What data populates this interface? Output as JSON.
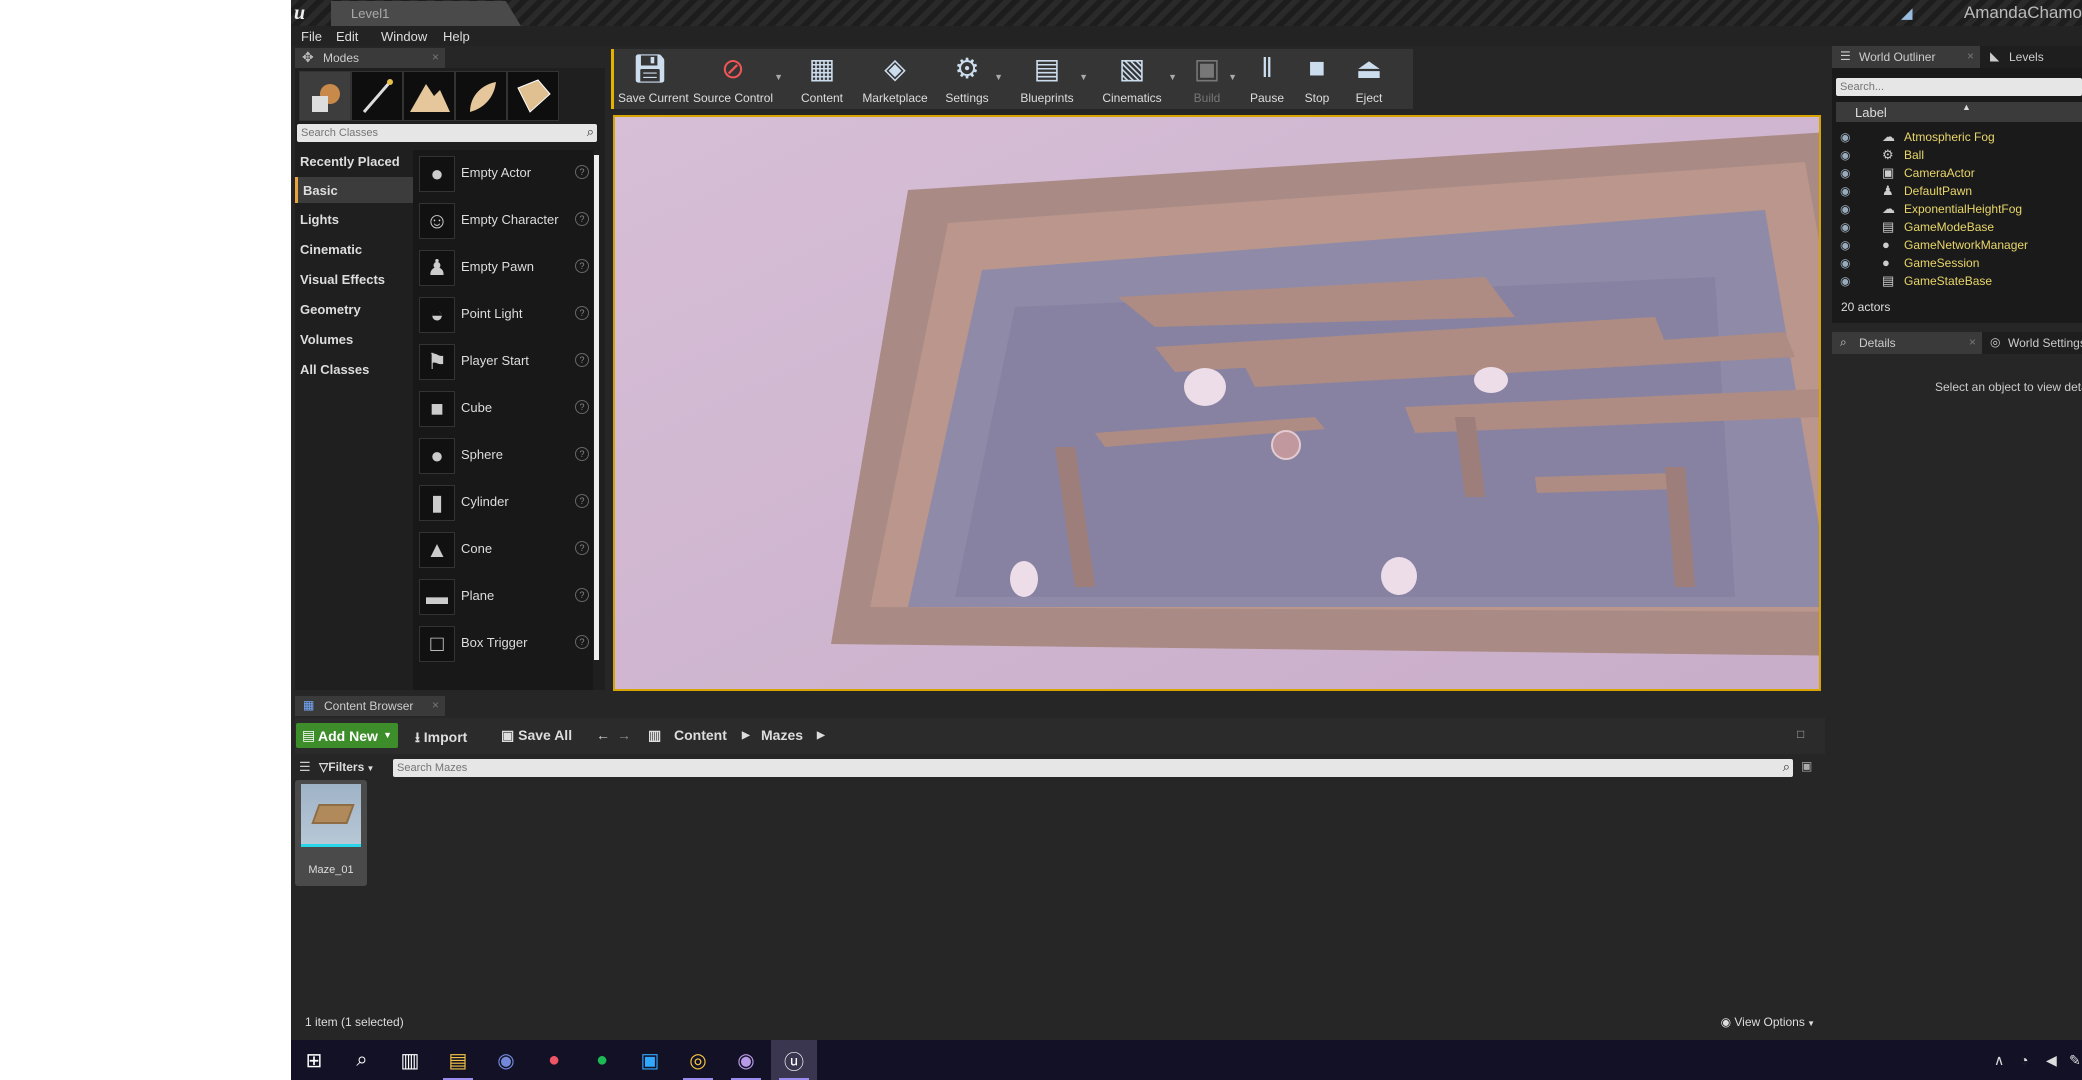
{
  "window": {
    "doc_tab": "Level1",
    "user": "AmandaChamo"
  },
  "menu": [
    "File",
    "Edit",
    "Window",
    "Help"
  ],
  "modes": {
    "tab_label": "Modes",
    "search_placeholder": "Search Classes",
    "categories": [
      "Recently Placed",
      "Basic",
      "Lights",
      "Cinematic",
      "Visual Effects",
      "Geometry",
      "Volumes",
      "All Classes"
    ],
    "active_category": "Basic",
    "items": [
      "Empty Actor",
      "Empty Character",
      "Empty Pawn",
      "Point Light",
      "Player Start",
      "Cube",
      "Sphere",
      "Cylinder",
      "Cone",
      "Plane",
      "Box Trigger"
    ]
  },
  "toolbar": {
    "buttons": [
      "Save Current",
      "Source Control",
      "Content",
      "Marketplace",
      "Settings",
      "Blueprints",
      "Cinematics",
      "Build",
      "Pause",
      "Stop",
      "Eject"
    ]
  },
  "outliner": {
    "tabs": [
      "World Outliner",
      "Levels"
    ],
    "search_placeholder": "Search...",
    "column_label": "Label",
    "actors": [
      "Atmospheric Fog",
      "Ball",
      "CameraActor",
      "DefaultPawn",
      "ExponentialHeightFog",
      "GameModeBase",
      "GameNetworkManager",
      "GameSession",
      "GameStateBase"
    ],
    "count": "20 actors"
  },
  "details": {
    "tabs": [
      "Details",
      "World Settings"
    ],
    "message": "Select an object to view details."
  },
  "content_browser": {
    "tab_label": "Content Browser",
    "add_new": "Add New",
    "import": "Import",
    "save_all": "Save All",
    "breadcrumb": [
      "Content",
      "Mazes"
    ],
    "filters": "Filters",
    "search_placeholder": "Search Mazes",
    "assets": [
      {
        "name": "Maze_01"
      }
    ],
    "status": "1 item (1 selected)",
    "view_options": "View Options"
  },
  "colors": {
    "accent": "#e5b200",
    "add_new": "#3e8d2b",
    "outliner_text": "#e8d66a",
    "viewport_bg": "#cfb6cf"
  }
}
